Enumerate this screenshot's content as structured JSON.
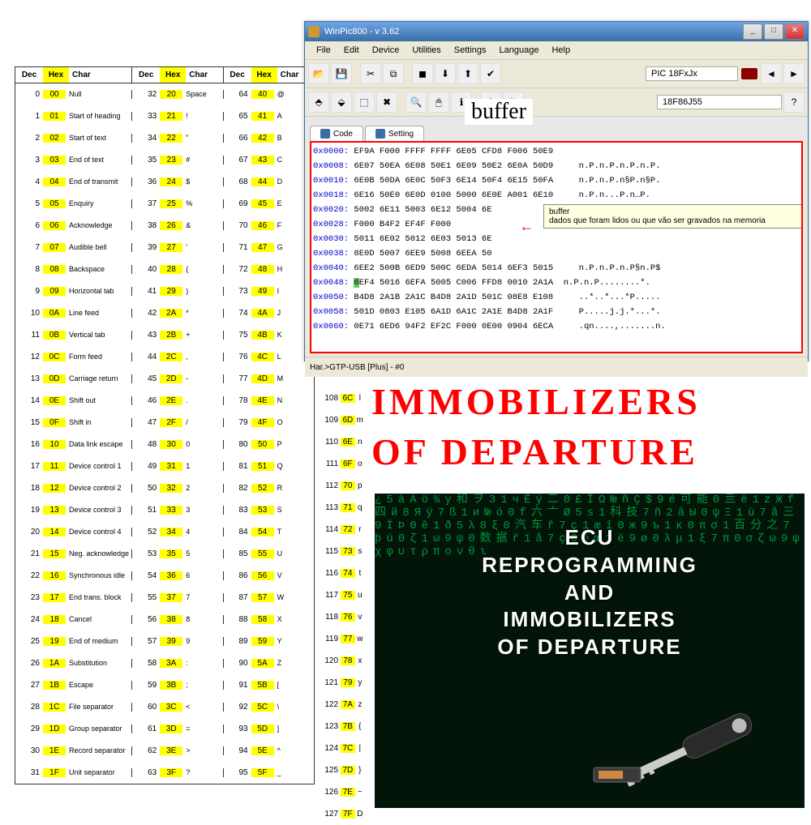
{
  "ascii": {
    "headers": [
      "Dec",
      "Hex",
      "Char"
    ],
    "group1": [
      {
        "dec": "0",
        "hex": "00",
        "char": "Null"
      },
      {
        "dec": "1",
        "hex": "01",
        "char": "Start of heading"
      },
      {
        "dec": "2",
        "hex": "02",
        "char": "Start of text"
      },
      {
        "dec": "3",
        "hex": "03",
        "char": "End of text"
      },
      {
        "dec": "4",
        "hex": "04",
        "char": "End of transmit"
      },
      {
        "dec": "5",
        "hex": "05",
        "char": "Enquiry"
      },
      {
        "dec": "6",
        "hex": "06",
        "char": "Acknowledge"
      },
      {
        "dec": "7",
        "hex": "07",
        "char": "Audible bell"
      },
      {
        "dec": "8",
        "hex": "08",
        "char": "Backspace"
      },
      {
        "dec": "9",
        "hex": "09",
        "char": "Horizontal tab"
      },
      {
        "dec": "10",
        "hex": "0A",
        "char": "Line feed"
      },
      {
        "dec": "11",
        "hex": "0B",
        "char": "Vertical tab"
      },
      {
        "dec": "12",
        "hex": "0C",
        "char": "Form feed"
      },
      {
        "dec": "13",
        "hex": "0D",
        "char": "Carriage return"
      },
      {
        "dec": "14",
        "hex": "0E",
        "char": "Shift out"
      },
      {
        "dec": "15",
        "hex": "0F",
        "char": "Shift in"
      },
      {
        "dec": "16",
        "hex": "10",
        "char": "Data link escape"
      },
      {
        "dec": "17",
        "hex": "11",
        "char": "Device control 1"
      },
      {
        "dec": "18",
        "hex": "12",
        "char": "Device control 2"
      },
      {
        "dec": "19",
        "hex": "13",
        "char": "Device control 3"
      },
      {
        "dec": "20",
        "hex": "14",
        "char": "Device control 4"
      },
      {
        "dec": "21",
        "hex": "15",
        "char": "Neg. acknowledge"
      },
      {
        "dec": "22",
        "hex": "16",
        "char": "Synchronous idle"
      },
      {
        "dec": "23",
        "hex": "17",
        "char": "End trans. block"
      },
      {
        "dec": "24",
        "hex": "18",
        "char": "Cancel"
      },
      {
        "dec": "25",
        "hex": "19",
        "char": "End of medium"
      },
      {
        "dec": "26",
        "hex": "1A",
        "char": "Substitution"
      },
      {
        "dec": "27",
        "hex": "1B",
        "char": "Escape"
      },
      {
        "dec": "28",
        "hex": "1C",
        "char": "File separator"
      },
      {
        "dec": "29",
        "hex": "1D",
        "char": "Group separator"
      },
      {
        "dec": "30",
        "hex": "1E",
        "char": "Record separator"
      },
      {
        "dec": "31",
        "hex": "1F",
        "char": "Unit separator"
      }
    ],
    "group2": [
      {
        "dec": "32",
        "hex": "20",
        "char": "Space"
      },
      {
        "dec": "33",
        "hex": "21",
        "char": "!"
      },
      {
        "dec": "34",
        "hex": "22",
        "char": "\""
      },
      {
        "dec": "35",
        "hex": "23",
        "char": "#"
      },
      {
        "dec": "36",
        "hex": "24",
        "char": "$"
      },
      {
        "dec": "37",
        "hex": "25",
        "char": "%"
      },
      {
        "dec": "38",
        "hex": "26",
        "char": "&"
      },
      {
        "dec": "39",
        "hex": "27",
        "char": "'"
      },
      {
        "dec": "40",
        "hex": "28",
        "char": "("
      },
      {
        "dec": "41",
        "hex": "29",
        "char": ")"
      },
      {
        "dec": "42",
        "hex": "2A",
        "char": "*"
      },
      {
        "dec": "43",
        "hex": "2B",
        "char": "+"
      },
      {
        "dec": "44",
        "hex": "2C",
        "char": ","
      },
      {
        "dec": "45",
        "hex": "2D",
        "char": "-"
      },
      {
        "dec": "46",
        "hex": "2E",
        "char": "."
      },
      {
        "dec": "47",
        "hex": "2F",
        "char": "/"
      },
      {
        "dec": "48",
        "hex": "30",
        "char": "0"
      },
      {
        "dec": "49",
        "hex": "31",
        "char": "1"
      },
      {
        "dec": "50",
        "hex": "32",
        "char": "2"
      },
      {
        "dec": "51",
        "hex": "33",
        "char": "3"
      },
      {
        "dec": "52",
        "hex": "34",
        "char": "4"
      },
      {
        "dec": "53",
        "hex": "35",
        "char": "5"
      },
      {
        "dec": "54",
        "hex": "36",
        "char": "6"
      },
      {
        "dec": "55",
        "hex": "37",
        "char": "7"
      },
      {
        "dec": "56",
        "hex": "38",
        "char": "8"
      },
      {
        "dec": "57",
        "hex": "39",
        "char": "9"
      },
      {
        "dec": "58",
        "hex": "3A",
        "char": ":"
      },
      {
        "dec": "59",
        "hex": "3B",
        "char": ";"
      },
      {
        "dec": "60",
        "hex": "3C",
        "char": "<"
      },
      {
        "dec": "61",
        "hex": "3D",
        "char": "="
      },
      {
        "dec": "62",
        "hex": "3E",
        "char": ">"
      },
      {
        "dec": "63",
        "hex": "3F",
        "char": "?"
      }
    ],
    "group3": [
      {
        "dec": "64",
        "hex": "40",
        "char": "@"
      },
      {
        "dec": "65",
        "hex": "41",
        "char": "A"
      },
      {
        "dec": "66",
        "hex": "42",
        "char": "B"
      },
      {
        "dec": "67",
        "hex": "43",
        "char": "C"
      },
      {
        "dec": "68",
        "hex": "44",
        "char": "D"
      },
      {
        "dec": "69",
        "hex": "45",
        "char": "E"
      },
      {
        "dec": "70",
        "hex": "46",
        "char": "F"
      },
      {
        "dec": "71",
        "hex": "47",
        "char": "G"
      },
      {
        "dec": "72",
        "hex": "48",
        "char": "H"
      },
      {
        "dec": "73",
        "hex": "49",
        "char": "I"
      },
      {
        "dec": "74",
        "hex": "4A",
        "char": "J"
      },
      {
        "dec": "75",
        "hex": "4B",
        "char": "K"
      },
      {
        "dec": "76",
        "hex": "4C",
        "char": "L"
      },
      {
        "dec": "77",
        "hex": "4D",
        "char": "M"
      },
      {
        "dec": "78",
        "hex": "4E",
        "char": "N"
      },
      {
        "dec": "79",
        "hex": "4F",
        "char": "O"
      },
      {
        "dec": "80",
        "hex": "50",
        "char": "P"
      },
      {
        "dec": "81",
        "hex": "51",
        "char": "Q"
      },
      {
        "dec": "82",
        "hex": "52",
        "char": "R"
      },
      {
        "dec": "83",
        "hex": "53",
        "char": "S"
      },
      {
        "dec": "84",
        "hex": "54",
        "char": "T"
      },
      {
        "dec": "85",
        "hex": "55",
        "char": "U"
      },
      {
        "dec": "86",
        "hex": "56",
        "char": "V"
      },
      {
        "dec": "87",
        "hex": "57",
        "char": "W"
      },
      {
        "dec": "88",
        "hex": "58",
        "char": "X"
      },
      {
        "dec": "89",
        "hex": "59",
        "char": "Y"
      },
      {
        "dec": "90",
        "hex": "5A",
        "char": "Z"
      },
      {
        "dec": "91",
        "hex": "5B",
        "char": "["
      },
      {
        "dec": "92",
        "hex": "5C",
        "char": "\\"
      },
      {
        "dec": "93",
        "hex": "5D",
        "char": "]"
      },
      {
        "dec": "94",
        "hex": "5E",
        "char": "^"
      },
      {
        "dec": "95",
        "hex": "5F",
        "char": "_"
      }
    ]
  },
  "ascii_ext": [
    {
      "dec": "108",
      "hex": "6C",
      "char": "l"
    },
    {
      "dec": "109",
      "hex": "6D",
      "char": "m"
    },
    {
      "dec": "110",
      "hex": "6E",
      "char": "n"
    },
    {
      "dec": "111",
      "hex": "6F",
      "char": "o"
    },
    {
      "dec": "112",
      "hex": "70",
      "char": "p"
    },
    {
      "dec": "113",
      "hex": "71",
      "char": "q"
    },
    {
      "dec": "114",
      "hex": "72",
      "char": "r"
    },
    {
      "dec": "115",
      "hex": "73",
      "char": "s"
    },
    {
      "dec": "116",
      "hex": "74",
      "char": "t"
    },
    {
      "dec": "117",
      "hex": "75",
      "char": "u"
    },
    {
      "dec": "118",
      "hex": "76",
      "char": "v"
    },
    {
      "dec": "119",
      "hex": "77",
      "char": "w"
    },
    {
      "dec": "120",
      "hex": "78",
      "char": "x"
    },
    {
      "dec": "121",
      "hex": "79",
      "char": "y"
    },
    {
      "dec": "122",
      "hex": "7A",
      "char": "z"
    },
    {
      "dec": "123",
      "hex": "7B",
      "char": "{"
    },
    {
      "dec": "124",
      "hex": "7C",
      "char": "|"
    },
    {
      "dec": "125",
      "hex": "7D",
      "char": "}"
    },
    {
      "dec": "126",
      "hex": "7E",
      "char": "~"
    },
    {
      "dec": "127",
      "hex": "7F",
      "char": "D"
    }
  ],
  "winpic": {
    "title": "WinPic800   -   v 3.62",
    "menu": [
      "File",
      "Edit",
      "Device",
      "Utilities",
      "Settings",
      "Language",
      "Help"
    ],
    "device_family": "PIC 18FxJx",
    "device_part": "18F86J55",
    "buffer_label": "buffer",
    "tabs": [
      "Code",
      "Setting"
    ],
    "hex_lines": [
      {
        "addr": "0x0000:",
        "bytes": "EF9A F000 FFFF FFFF 6E05 CFD8 F006 50E9",
        "ascii": ""
      },
      {
        "addr": "0x0008:",
        "bytes": "6E07 50EA 6E08 50E1 6E09 50E2 6E0A 50D9",
        "ascii": "n.P.n.P.n.P.n.P."
      },
      {
        "addr": "0x0010:",
        "bytes": "6E0B 50DA 6E0C 50F3 6E14 50F4 6E15 50FA",
        "ascii": "n.P.n.P.n§P.n§P."
      },
      {
        "addr": "0x0018:",
        "bytes": "6E16 50E0 6E0D 0100 5000 6E0E A001 6E10",
        "ascii": "n.P.n...P.n…P."
      },
      {
        "addr": "0x0020:",
        "bytes": "5002 6E11 5003 6E12 5004 6E",
        "ascii": ""
      },
      {
        "addr": "0x0028:",
        "bytes": "F000 B4F2 EF4F F000",
        "ascii": ""
      },
      {
        "addr": "0x0030:",
        "bytes": "5011 6E02 5012 6E03 5013 6E",
        "ascii": ""
      },
      {
        "addr": "0x0038:",
        "bytes": "8E0D 5007 6EE9 5008 6EEA 50",
        "ascii": ""
      },
      {
        "addr": "0x0040:",
        "bytes": "6EE2 500B 6ED9 500C 6EDA 5014 6EF3 5015",
        "ascii": "n.P.n.P.n.P§n.P$"
      },
      {
        "addr": "0x0048:",
        "bytes": "6EF4 5016 6EFA 5005 C006 FFD8 0010 2A1A",
        "ascii": "n.P.n.P........*."
      },
      {
        "addr": "0x0050:",
        "bytes": "B4D8 2A1B 2A1C B4D8 2A1D 501C 08E8 E108",
        "ascii": "..*..*...*P....."
      },
      {
        "addr": "0x0058:",
        "bytes": "501D 0803 E105 6A1D 6A1C 2A1E B4D8 2A1F",
        "ascii": "P.....j.j.*...*."
      },
      {
        "addr": "0x0060:",
        "bytes": "0E71 6ED6 94F2 EF2C F000 0E00 0904 6ECA",
        "ascii": ".qn....,.......n."
      }
    ],
    "tooltip_title": "buffer",
    "tooltip_body": "dados que foram lidos ou que vão ser gravados na memoria",
    "statusbar": "Har.>GTP-USB [Plus] - #0"
  },
  "big_title": {
    "line1": "IMMOBILIZERS",
    "line2": "OF DEPARTURE"
  },
  "book": {
    "line1": "ECU",
    "line2": "REPROGRAMMING",
    "line3": "AND",
    "line4": "IMMOBILIZERS",
    "line5": "OF DEPARTURE",
    "matrix": "¿5àÁö¾у和ヲ31чÊý二0£ĪΩ№ñÇ$9é可能0亖ë1zЖf四й8Яÿ7ß1и№ó0f六亠Ø5s1科技7ñ2âЫ0ψΞ1ù7å三9ÏÞ0ě1ð5λ8ξ0汽车ř7ç1æî0ж9ъ1κ0πσ1百分之7þú0ζ1ω9ψ0数据ř1å7ç0ёœ1ё9ø0λμ1ξ7π0σζω9ψχφυτρπονθι"
  }
}
